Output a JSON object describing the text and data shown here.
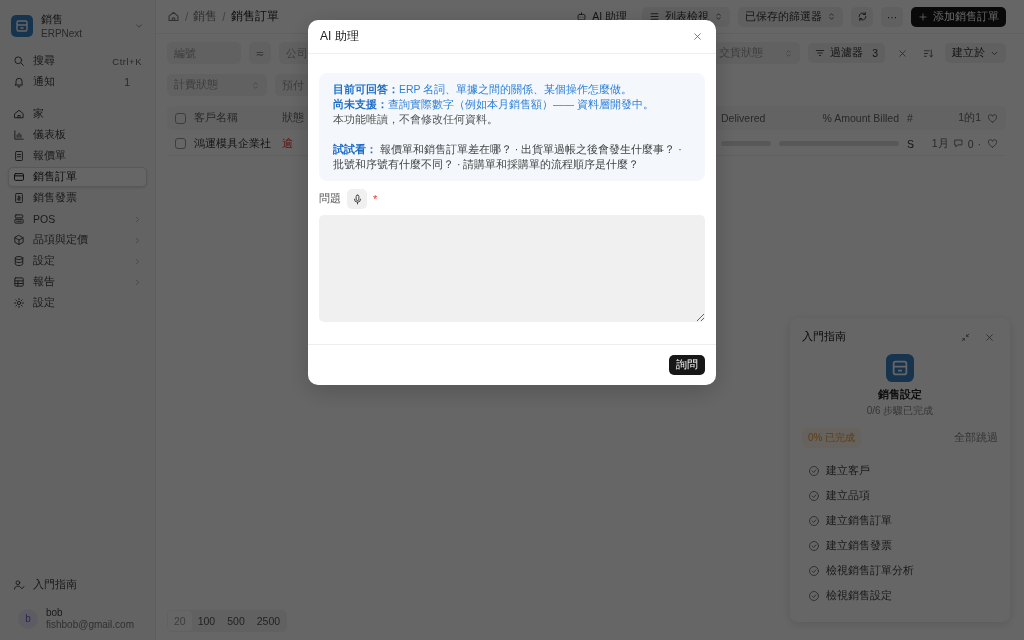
{
  "sidebar": {
    "app": {
      "title": "銷售",
      "subtitle": "ERPNext"
    },
    "utilities": [
      {
        "label": "搜尋",
        "hint": "Ctrl+K"
      },
      {
        "label": "通知",
        "count": "1"
      }
    ],
    "items": [
      {
        "label": "家",
        "selected": false,
        "expandable": false
      },
      {
        "label": "儀表板",
        "selected": false,
        "expandable": false
      },
      {
        "label": "報價單",
        "selected": false,
        "expandable": false
      },
      {
        "label": "銷售訂單",
        "selected": true,
        "expandable": false
      },
      {
        "label": "銷售發票",
        "selected": false,
        "expandable": false
      },
      {
        "label": "POS",
        "selected": false,
        "expandable": true
      },
      {
        "label": "品項與定價",
        "selected": false,
        "expandable": true
      },
      {
        "label": "設定",
        "selected": false,
        "expandable": true
      },
      {
        "label": "報告",
        "selected": false,
        "expandable": true
      },
      {
        "label": "設定",
        "selected": false,
        "expandable": false
      }
    ],
    "footer_link": "入門指南",
    "user": {
      "avatar": "b",
      "name": "bob",
      "email": "fishbob@gmail.com"
    }
  },
  "breadcrumbs": [
    {
      "separator": "/",
      "label": "銷售"
    },
    {
      "separator": "/",
      "label": "銷售訂單"
    }
  ],
  "toolbar": {
    "ai_button": "AI 助理",
    "view_select": "列表檢視",
    "saved_filters": "已保存的篩選器",
    "more": "···",
    "primary": "添加銷售訂單"
  },
  "filters": {
    "row_1": [
      {
        "kind": "input",
        "placeholder": "編號"
      },
      {
        "kind": "operator",
        "label": "≂"
      },
      {
        "kind": "input",
        "placeholder": "公司"
      }
    ],
    "row_1_right": [
      {
        "kind": "select",
        "placeholder": "交貨狀態"
      }
    ],
    "filter_button": {
      "label": "過濾器",
      "count": "3"
    },
    "sort": {
      "label": "建立於"
    },
    "row_2": [
      {
        "kind": "select",
        "placeholder": "計費狀態"
      },
      {
        "kind": "input",
        "placeholder": "預付"
      }
    ]
  },
  "table": {
    "select_all": {
      "checked": false
    },
    "columns": [
      "客戶名稱",
      "狀態"
    ],
    "columns_right": [
      "Delivered",
      "% Amount Billed",
      "#"
    ],
    "count": "1的1",
    "rows": [
      {
        "checked": false,
        "customer": "鴻運模具企業社",
        "status": "逾",
        "delivered": {
          "level": 0
        },
        "billed": {
          "level": 0
        },
        "column_s": "S",
        "date": "1月",
        "comments": "0",
        "separator": "·",
        "liked": false
      }
    ]
  },
  "page_sizes": [
    {
      "label": "20",
      "selected": true
    },
    {
      "label": "100",
      "selected": false
    },
    {
      "label": "500",
      "selected": false
    },
    {
      "label": "2500",
      "selected": false
    }
  ],
  "onboarding": {
    "title": "入門指南",
    "heading": "銷售設定",
    "progress": "0/6 步驟已完成",
    "badge": "0% 已完成",
    "skip": "全部跳過",
    "steps": [
      {
        "label": "建立客戶",
        "done": false
      },
      {
        "label": "建立品項",
        "done": false
      },
      {
        "label": "建立銷售訂單",
        "done": false
      },
      {
        "label": "建立銷售發票",
        "done": false
      },
      {
        "label": "檢視銷售訂單分析",
        "done": false
      },
      {
        "label": "檢視銷售設定",
        "done": false
      }
    ]
  },
  "modal": {
    "title": "AI 助理",
    "info": [
      {
        "kind": "info",
        "text": "**目前可回答：**ERP 名詞、單據之間的關係、某個操作怎麼做。"
      },
      {
        "kind": "info",
        "text": "**尚未支援：**查詢實際數字（例如本月銷售額）—— 資料層開發中。"
      },
      {
        "kind": "note",
        "text": "本功能唯讀，不會修改任何資料。"
      },
      {
        "kind": "examples",
        "text": "**試試看：** 報價單和銷售訂單差在哪？ · 出貨單過帳之後會發生什麼事？ · 批號和序號有什麼不同？ · 請購單和採購單的流程順序是什麼？"
      }
    ],
    "question": {
      "label": "問題",
      "required": true,
      "required_mark": "*"
    },
    "submit": "詢問"
  }
}
